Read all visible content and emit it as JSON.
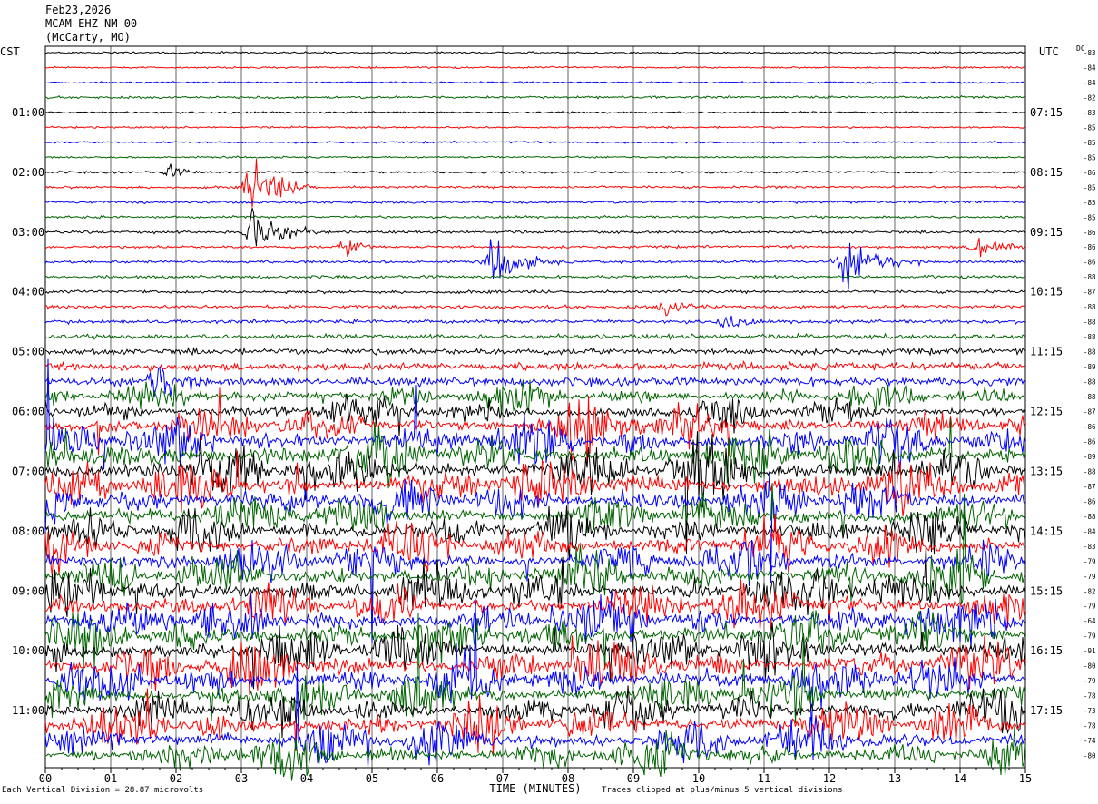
{
  "header": {
    "date": "Feb23,2026",
    "station": "MCAM EHZ NM 00",
    "location": "(McCarty, MO)"
  },
  "timezones": {
    "left": "CST",
    "right": "UTC",
    "dc": "DC"
  },
  "footer": {
    "scale_note": "Each Vertical Division = 28.87 microvolts",
    "clip_note": "Traces clipped at plus/minus 5 vertical divisions"
  },
  "chart_data": {
    "type": "line",
    "title": "",
    "xlabel": "TIME (MINUTES)",
    "x_ticks": [
      "00",
      "01",
      "02",
      "03",
      "04",
      "05",
      "06",
      "07",
      "08",
      "09",
      "10",
      "11",
      "12",
      "13",
      "14",
      "15"
    ],
    "xlim": [
      0,
      15
    ],
    "trace_count": 48,
    "trace_interval_minutes": 15,
    "trace_colors": [
      "#000000",
      "#ff0000",
      "#0000ff",
      "#006400"
    ],
    "left_hour_labels": [
      {
        "trace": 4,
        "label": "01:00"
      },
      {
        "trace": 8,
        "label": "02:00"
      },
      {
        "trace": 12,
        "label": "03:00"
      },
      {
        "trace": 16,
        "label": "04:00"
      },
      {
        "trace": 20,
        "label": "05:00"
      },
      {
        "trace": 24,
        "label": "06:00"
      },
      {
        "trace": 28,
        "label": "07:00"
      },
      {
        "trace": 32,
        "label": "08:00"
      },
      {
        "trace": 36,
        "label": "09:00"
      },
      {
        "trace": 40,
        "label": "10:00"
      },
      {
        "trace": 44,
        "label": "11:00"
      }
    ],
    "right_hour_labels": [
      {
        "trace": 4,
        "label": "07:15"
      },
      {
        "trace": 8,
        "label": "08:15"
      },
      {
        "trace": 12,
        "label": "09:15"
      },
      {
        "trace": 16,
        "label": "10:15"
      },
      {
        "trace": 20,
        "label": "11:15"
      },
      {
        "trace": 24,
        "label": "12:15"
      },
      {
        "trace": 28,
        "label": "13:15"
      },
      {
        "trace": 32,
        "label": "14:15"
      },
      {
        "trace": 36,
        "label": "15:15"
      },
      {
        "trace": 40,
        "label": "16:15"
      },
      {
        "trace": 44,
        "label": "17:15"
      }
    ],
    "dc_offsets": [
      -83,
      -84,
      -84,
      -82,
      -83,
      -85,
      -85,
      -85,
      -86,
      -85,
      -85,
      -85,
      -86,
      -86,
      -86,
      -88,
      -87,
      -88,
      -88,
      -88,
      -88,
      -89,
      -88,
      -88,
      -87,
      -86,
      -86,
      -89,
      -88,
      -87,
      -86,
      -88,
      -84,
      -83,
      -79,
      -79,
      -82,
      -79,
      -64,
      -79,
      -91,
      -80,
      -79,
      -78,
      -73,
      -78,
      -74,
      -80
    ],
    "activity_level": [
      0.3,
      0.3,
      0.3,
      0.4,
      0.3,
      0.3,
      0.3,
      0.3,
      0.35,
      0.4,
      0.4,
      0.4,
      0.45,
      0.45,
      0.45,
      0.5,
      0.5,
      0.55,
      0.6,
      0.75,
      1.0,
      1.2,
      1.4,
      1.6,
      1.8,
      2.2,
      2.6,
      3.0,
      3.0,
      3.0,
      2.8,
      2.6,
      2.6,
      2.6,
      2.6,
      2.6,
      2.8,
      2.8,
      2.8,
      2.8,
      2.8,
      2.8,
      2.8,
      2.6,
      2.6,
      2.6,
      2.6,
      2.4
    ],
    "events": [
      {
        "trace": 8,
        "minute": 1.9,
        "width": 0.35,
        "amp": 5
      },
      {
        "trace": 9,
        "minute": 3.2,
        "width": 0.6,
        "amp": 22
      },
      {
        "trace": 12,
        "minute": 3.2,
        "width": 0.6,
        "amp": 22
      },
      {
        "trace": 13,
        "minute": 4.6,
        "width": 0.35,
        "amp": 9
      },
      {
        "trace": 14,
        "minute": 6.9,
        "width": 0.6,
        "amp": 18
      },
      {
        "trace": 14,
        "minute": 12.3,
        "width": 0.7,
        "amp": 18
      },
      {
        "trace": 13,
        "minute": 14.3,
        "width": 0.5,
        "amp": 12
      },
      {
        "trace": 17,
        "minute": 9.5,
        "width": 0.5,
        "amp": 6
      },
      {
        "trace": 18,
        "minute": 10.4,
        "width": 0.4,
        "amp": 6
      },
      {
        "trace": 22,
        "minute": 1.7,
        "width": 0.5,
        "amp": 16
      },
      {
        "trace": 25,
        "minute": 8.1,
        "width": 0.8,
        "amp": 20
      }
    ]
  }
}
